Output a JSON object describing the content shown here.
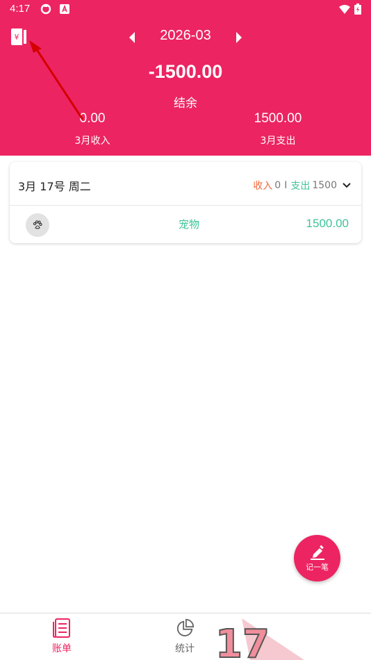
{
  "status_bar": {
    "time": "4:17",
    "icons": [
      "sync-icon",
      "app-a-icon",
      "wifi-icon",
      "battery-icon"
    ]
  },
  "header": {
    "book_icon": "yen-account-book-icon",
    "month": "2026-03",
    "balance": "-1500.00",
    "balance_label": "结余",
    "income_value": "0.00",
    "income_label": "3月收入",
    "expense_value": "1500.00",
    "expense_label": "3月支出"
  },
  "day_card": {
    "date_label": "3月 17号 周二",
    "income_label": "收入",
    "income_value": "0",
    "separator": "I",
    "expense_label": "支出",
    "expense_value": "1500",
    "entries": [
      {
        "icon": "paw-icon",
        "category": "宠物",
        "amount": "1500.00"
      }
    ]
  },
  "fab": {
    "icon": "pencil-icon",
    "label": "记一笔"
  },
  "bottom_nav": {
    "items": [
      {
        "icon": "bills-icon",
        "label": "账单",
        "active": true
      },
      {
        "icon": "pie-chart-icon",
        "label": "统计",
        "active": false
      }
    ]
  },
  "colors": {
    "accent": "#ec2462",
    "income": "#f0683b",
    "expense": "#3ec39a"
  }
}
